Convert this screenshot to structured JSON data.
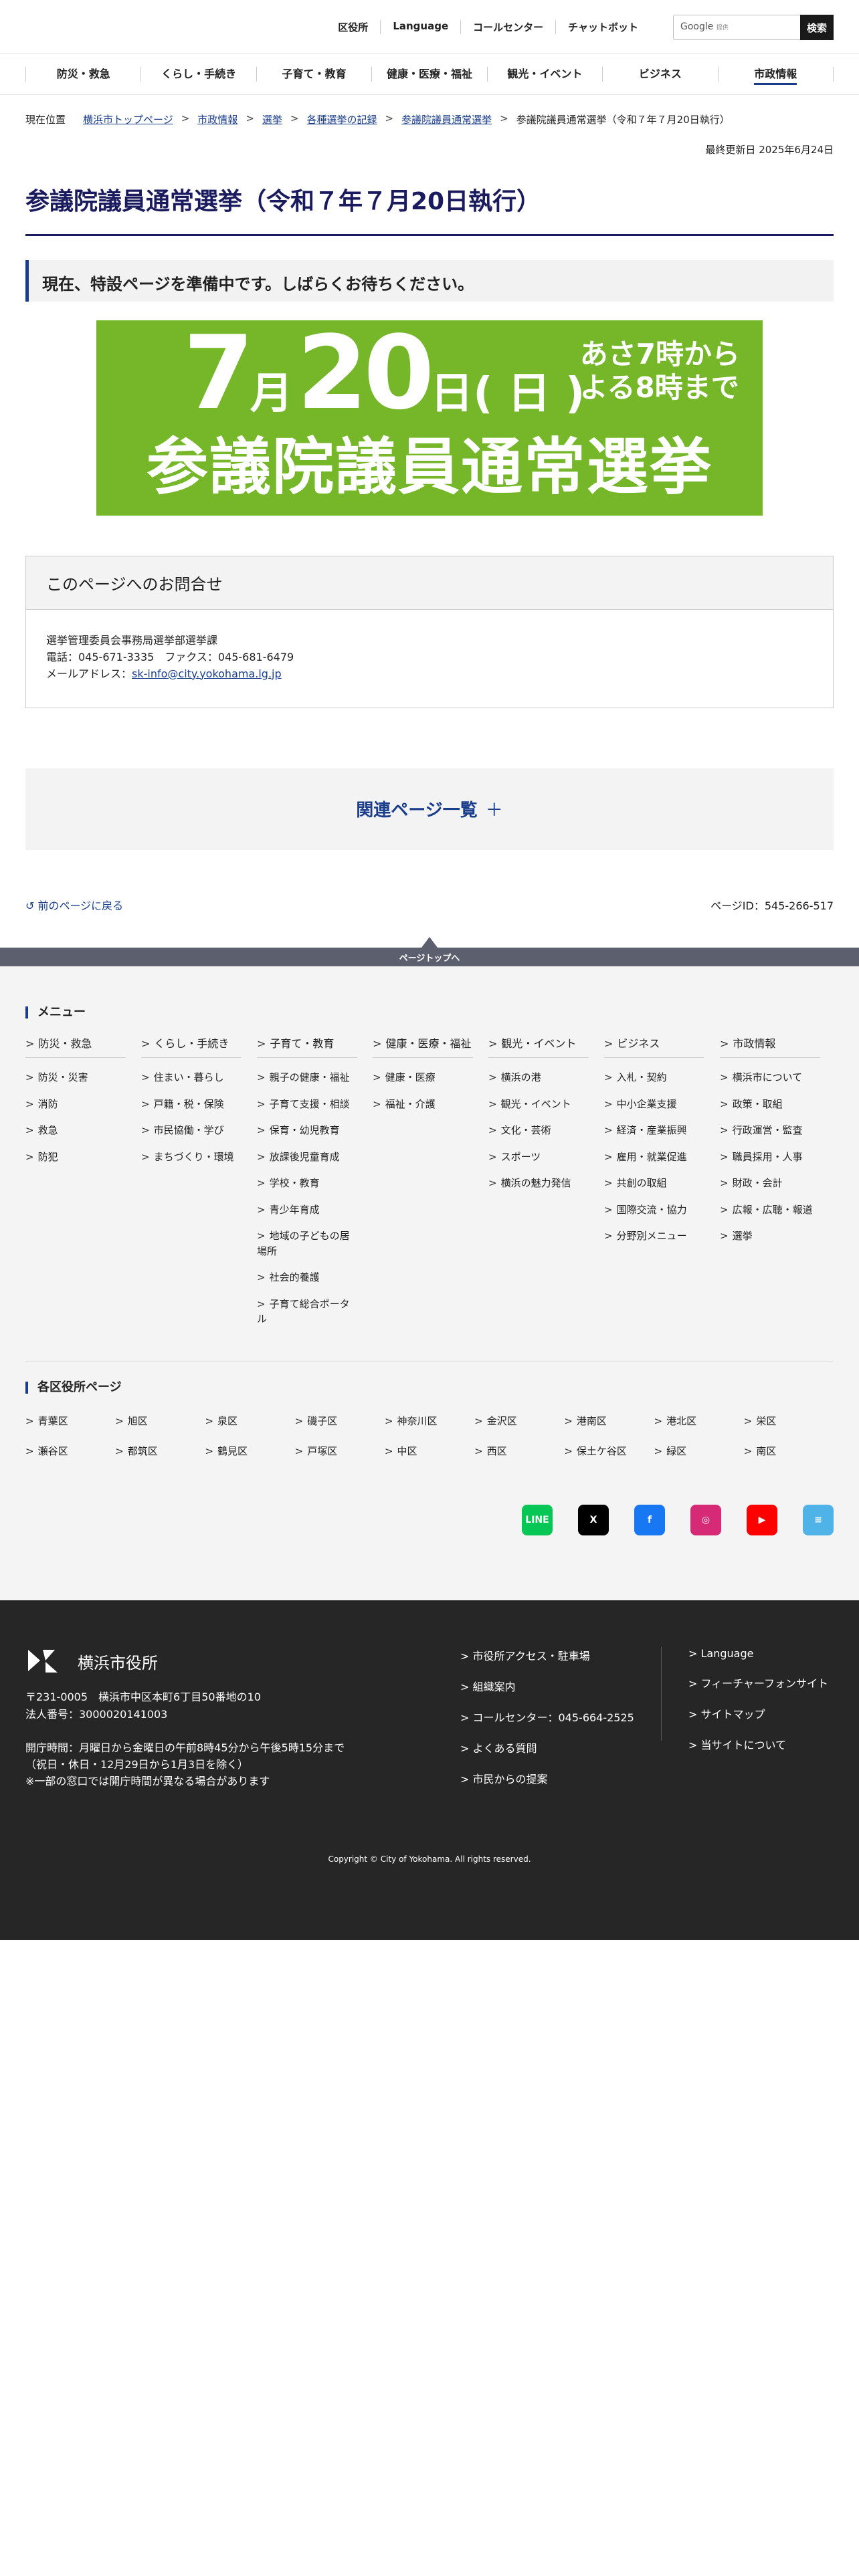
{
  "utility": {
    "links": [
      "区役所",
      "Language",
      "コールセンター",
      "チャットボット"
    ],
    "search_placeholder": "Google",
    "search_provider_small": "提供",
    "search_button": "検索"
  },
  "gnav": [
    "防災・救急",
    "くらし・手続き",
    "子育て・教育",
    "健康・医療・福祉",
    "観光・イベント",
    "ビジネス",
    "市政情報"
  ],
  "gnav_active": "市政情報",
  "breadcrumb": {
    "label": "現在位置",
    "links": [
      "横浜市トップページ",
      "市政情報",
      "選挙",
      "各種選挙の記録",
      "参議院議員通常選挙"
    ],
    "current": "参議院議員通常選挙（令和７年７月20日執行）"
  },
  "updated": "最終更新日 2025年6月24日",
  "page_title": "参議院議員通常選挙（令和７年７月20日執行）",
  "notice": "現在、特設ページを準備中です。しばらくお待ちください。",
  "banner": {
    "month_num": "7",
    "month_kanji": "月",
    "day_num": "20",
    "day_kanji": "日",
    "weekday": "( 日 )",
    "time_line1": "あさ7時から",
    "time_line2": "よる8時まで",
    "title": "参議院議員通常選挙",
    "bg_color": "#76b72a"
  },
  "inquiry": {
    "heading": "このページへのお問合せ",
    "dept": "選挙管理委員会事務局選挙部選挙課",
    "phone": "電話：045-671-3335　ファクス：045-681-6479",
    "email_label": "メールアドレス：",
    "email": "sk-info@city.yokohama.lg.jp"
  },
  "related": {
    "label": "関連ページ一覧",
    "icon": "plus-icon"
  },
  "back_link": "前のページに戻る",
  "page_id": "ページID：545-266-517",
  "pagetop": "ページトップへ",
  "menu": {
    "title": "メニュー",
    "columns": [
      {
        "head": "防災・救急",
        "items": [
          "防災・災害",
          "消防",
          "救急",
          "防犯"
        ]
      },
      {
        "head": "くらし・手続き",
        "items": [
          "住まい・暮らし",
          "戸籍・税・保険",
          "市民協働・学び",
          "まちづくり・環境"
        ]
      },
      {
        "head": "子育て・教育",
        "items": [
          "親子の健康・福祉",
          "子育て支援・相談",
          "保育・幼児教育",
          "放課後児童育成",
          "学校・教育",
          "青少年育成",
          "地域の子どもの居場所",
          "社会的養護",
          "子育て総合ポータル"
        ]
      },
      {
        "head": "健康・医療・福祉",
        "items": [
          "健康・医療",
          "福祉・介護"
        ]
      },
      {
        "head": "観光・イベント",
        "items": [
          "横浜の港",
          "観光・イベント",
          "文化・芸術",
          "スポーツ",
          "横浜の魅力発信"
        ]
      },
      {
        "head": "ビジネス",
        "items": [
          "入札・契約",
          "中小企業支援",
          "経済・産業振興",
          "雇用・就業促進",
          "共創の取組",
          "国際交流・協力",
          "分野別メニュー"
        ]
      },
      {
        "head": "市政情報",
        "items": [
          "横浜市について",
          "政策・取組",
          "行政運営・監査",
          "職員採用・人事",
          "財政・会計",
          "広報・広聴・報道",
          "選挙"
        ]
      }
    ]
  },
  "wards": {
    "title": "各区役所ページ",
    "items": [
      "青葉区",
      "旭区",
      "泉区",
      "磯子区",
      "神奈川区",
      "金沢区",
      "港南区",
      "港北区",
      "栄区",
      "瀬谷区",
      "都筑区",
      "鶴見区",
      "戸塚区",
      "中区",
      "西区",
      "保土ケ谷区",
      "緑区",
      "南区"
    ]
  },
  "sns": [
    {
      "name": "line-icon",
      "label": "LINE",
      "color": "#06c755"
    },
    {
      "name": "x-icon",
      "label": "X",
      "color": "#000000"
    },
    {
      "name": "facebook-icon",
      "label": "f",
      "color": "#1877f2"
    },
    {
      "name": "instagram-icon",
      "label": "◎",
      "color": "#d62976"
    },
    {
      "name": "youtube-icon",
      "label": "▶",
      "color": "#ff0000"
    },
    {
      "name": "news-icon",
      "label": "≡",
      "color": "#4fb3e8"
    }
  ],
  "footer": {
    "city_name": "横浜市役所",
    "address": "〒231-0005　横浜市中区本町6丁目50番地の10",
    "corp_no": "法人番号：3000020141003",
    "hours1": "開庁時間：月曜日から金曜日の午前8時45分から午後5時15分まで",
    "hours2": "（祝日・休日・12月29日から1月3日を除く）",
    "hours3": "※一部の窓口では開庁時間が異なる場合があります",
    "links1": [
      "市役所アクセス・駐車場",
      "組織案内",
      "コールセンター：045-664-2525",
      "よくある質問",
      "市民からの提案"
    ],
    "links2": [
      "Language",
      "フィーチャーフォンサイト",
      "サイトマップ",
      "当サイトについて"
    ],
    "copyright": "Copyright © City of Yokohama. All rights reserved."
  }
}
